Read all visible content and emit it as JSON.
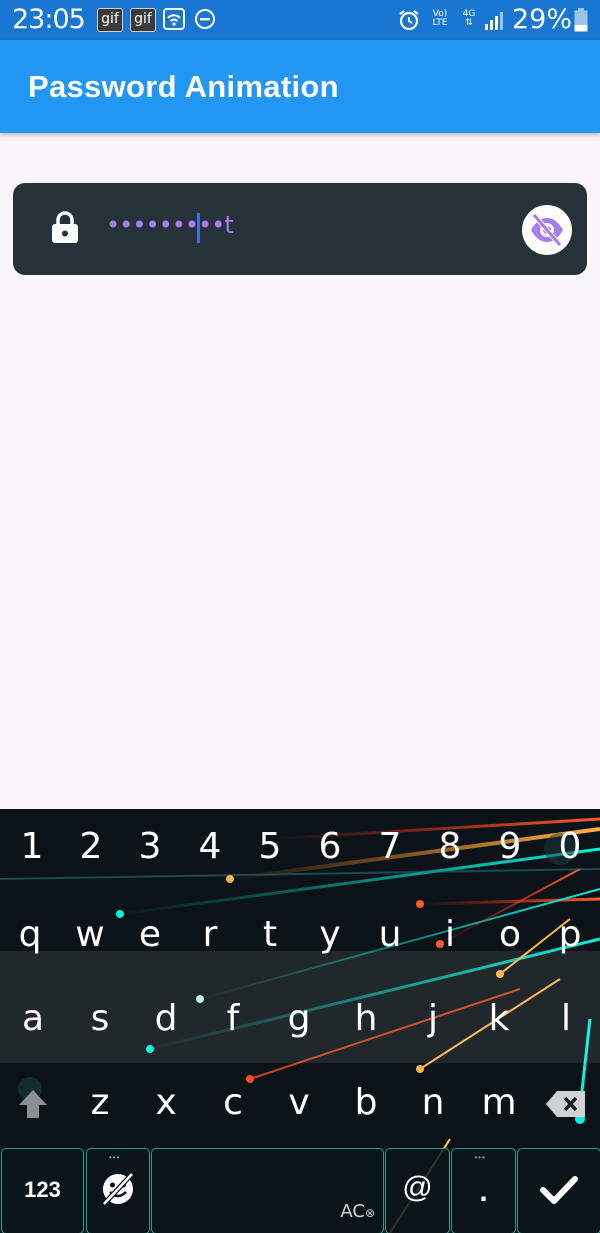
{
  "status_bar": {
    "time": "23:05",
    "notif_icons": [
      "gif",
      "gif"
    ],
    "battery": "29%",
    "volte_top": "Vo)",
    "volte_bottom": "LTE",
    "network": "4G"
  },
  "app_bar": {
    "title": "Password Animation"
  },
  "password_field": {
    "masked_value": "•••••••••t",
    "accent": "#a87df1",
    "background": "#263238"
  },
  "keyboard": {
    "number_row": [
      "1",
      "2",
      "3",
      "4",
      "5",
      "6",
      "7",
      "8",
      "9",
      "0"
    ],
    "row1": [
      "q",
      "w",
      "e",
      "r",
      "t",
      "y",
      "u",
      "i",
      "o",
      "p"
    ],
    "row2": [
      "a",
      "s",
      "d",
      "f",
      "g",
      "h",
      "j",
      "k",
      "l"
    ],
    "row3": [
      "z",
      "x",
      "c",
      "v",
      "b",
      "n",
      "m"
    ],
    "numbers_key": "123",
    "at_key": "@",
    "dot_key": ".",
    "autocorrect_label": "AC"
  }
}
